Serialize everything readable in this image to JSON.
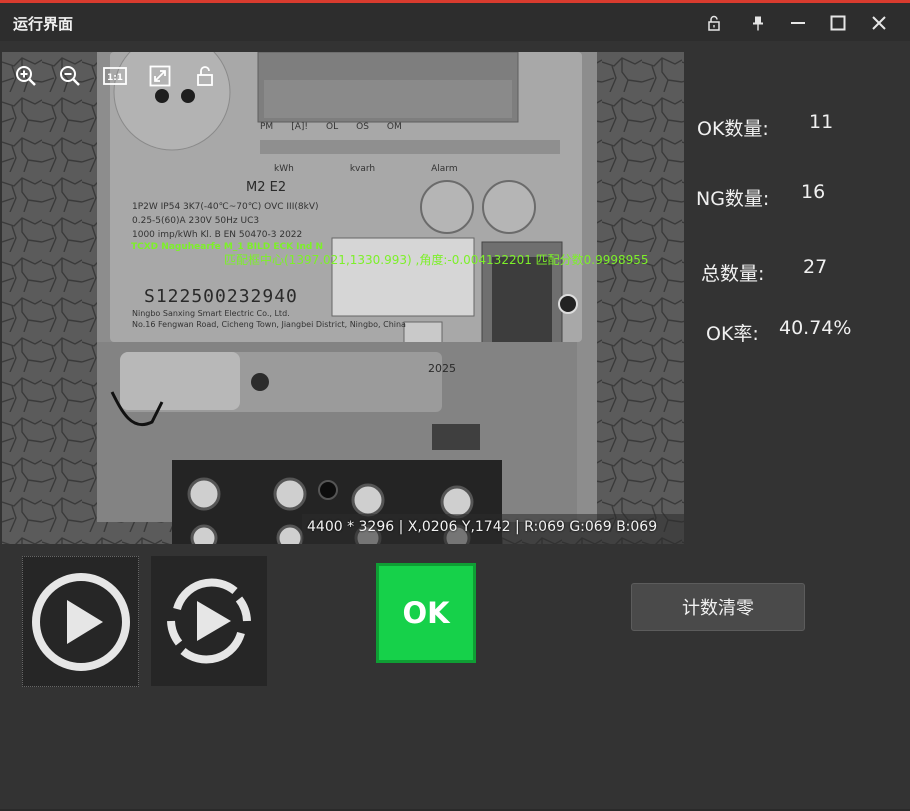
{
  "window": {
    "title": "运行界面"
  },
  "viewer": {
    "match_text": "匹配框中心(1397.021,1330.993) ,角度:-0.004132201 匹配分数0.9998955",
    "overlay_small": "TCXD Naguhearfe  M_1 BILD ECK Ind N",
    "status_bar": "4400 * 3296  |  X,0206  Y,1742  |  R:069  G:069  B:069",
    "meter_serial": "S122500232940",
    "meter_year": "2025",
    "meter_line1": "1P2W   IP54    3K7(-40℃~70℃)  OVC III(8kV)",
    "meter_line2": "0.25-5(60)A    230V  50Hz   UC3",
    "meter_line3": "1000 imp/kWh   Kl. B  EN 50470-3 2022",
    "meter_company": "Ningbo Sanxing Smart Electric Co., Ltd.",
    "meter_address": "No.16 Fengwan Road, Cicheng Town, Jiangbei District, Ningbo, China",
    "meter_indicators": [
      "PM",
      "[A]!",
      "OL",
      "OS",
      "OM"
    ],
    "meter_leds": [
      "kWh",
      "kvarh",
      "Alarm"
    ],
    "meter_model": "M2 E2"
  },
  "stats": {
    "ok_label": "OK数量:",
    "ok_value": "11",
    "ng_label": "NG数量:",
    "ng_value": "16",
    "total_label": "总数量:",
    "total_value": "27",
    "rate_label": "OK率:",
    "rate_value": "40.74%"
  },
  "result": {
    "text": "OK"
  },
  "controls": {
    "reset_label": "计数清零"
  },
  "colors": {
    "ok_green": "#16d14a",
    "overlay_green": "#7df029",
    "title_accent": "#d83b2e"
  },
  "icons": {
    "viewer_toolbar": [
      "zoom-in-icon",
      "zoom-out-icon",
      "actual-size-icon",
      "fit-image-icon",
      "unlock-icon"
    ],
    "window": [
      "unlock-icon",
      "pin-icon",
      "minimize-icon",
      "maximize-icon",
      "close-icon"
    ],
    "run": [
      "play-icon",
      "loop-play-icon"
    ]
  }
}
